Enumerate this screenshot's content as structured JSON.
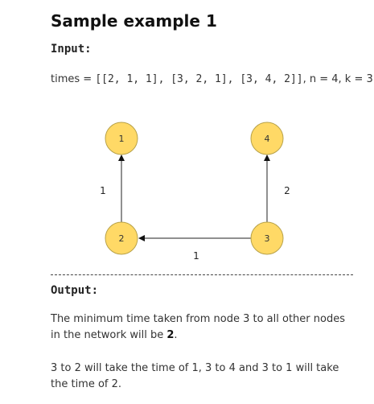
{
  "title": "Sample example 1",
  "input_label": "Input:",
  "input": {
    "times_prefix": "times = ",
    "times_value": "[[2, 1, 1], [3, 2, 1], [3, 4, 2]]",
    "rest": ", n = 4, k = 3"
  },
  "graph": {
    "node_fill": "#ffd966",
    "node_stroke": "#b8a24a",
    "nodes": [
      {
        "id": "node-1",
        "label": "1"
      },
      {
        "id": "node-4",
        "label": "4"
      },
      {
        "id": "node-2",
        "label": "2"
      },
      {
        "id": "node-3",
        "label": "3"
      }
    ],
    "edges": [
      {
        "from": "2",
        "to": "1",
        "weight": "1"
      },
      {
        "from": "3",
        "to": "4",
        "weight": "2"
      },
      {
        "from": "3",
        "to": "2",
        "weight": "1"
      }
    ]
  },
  "output_label": "Output:",
  "output": {
    "line1_prefix": "The minimum time taken from node 3 to all other nodes in the network will be ",
    "line1_value": "2",
    "line1_suffix": ".",
    "line2": "3 to 2 will take the time of 1, 3 to 4 and 3 to 1 will take the time of 2."
  }
}
